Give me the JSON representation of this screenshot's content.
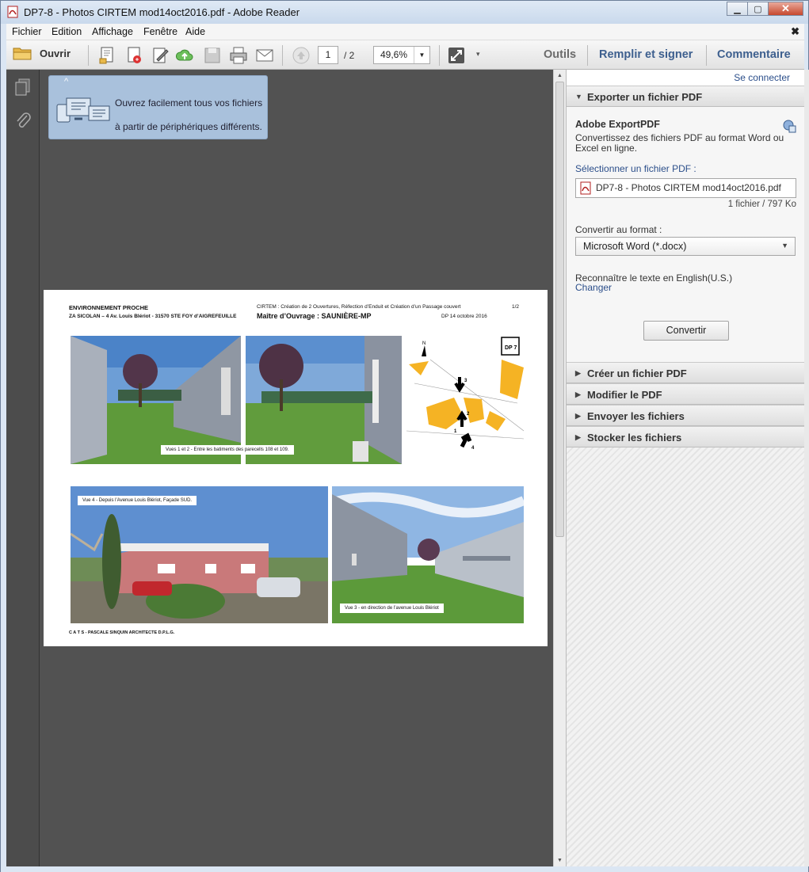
{
  "window": {
    "title": "DP7-8 - Photos CIRTEM mod14oct2016.pdf - Adobe Reader"
  },
  "menu": {
    "items": [
      "Fichier",
      "Edition",
      "Affichage",
      "Fenêtre",
      "Aide"
    ],
    "close_glyph": "✖"
  },
  "toolbar": {
    "open_label": "Ouvrir",
    "page_current": "1",
    "page_total": "/ 2",
    "zoom": "49,6%",
    "tools_label": "Outils",
    "fill_sign_label": "Remplir et signer",
    "comment_label": "Commentaire"
  },
  "promo": {
    "line1": "Ouvrez facilement tous vos fichiers",
    "line2": "à partir de périphériques différents."
  },
  "pdf_page": {
    "env_title": "ENVIRONNEMENT  PROCHE",
    "address": "ZA  SICOLAN – 4 Av. Louis Blériot  - 31570 STE FOY d’AIGREFEUILLE",
    "project": "CIRTEM :  Création de 2 Ouvertures,  Réfection d’Enduit et Création d’un Passage couvert",
    "page_num": "1/2",
    "owner": "Maître d’Ouvrage : SAUNIÈRE-MP",
    "dp_date": "DP 14 octobre 2016",
    "caption_vues12": "Vues 1 et 2  -  Entre les batiments des parecells 108 et 109.",
    "caption_vue4": "Vue 4 -  Depuis l’Avenue Louis Blériot, Façade SUD.",
    "caption_vue3": "Vue 3 -  en direction de l’avenue Louis Blériot",
    "footer": "C  A  T  S   -   PASCALE SINQUIN   ARCHITECTE D.P.L.G.",
    "map_labels": [
      "3",
      "2",
      "1",
      "4",
      "N"
    ],
    "dp_box": "DP 7"
  },
  "right_pane": {
    "sign_in": "Se connecter",
    "export_header": "Exporter un fichier PDF",
    "export_title": "Adobe ExportPDF",
    "export_desc": "Convertissez des fichiers PDF au format Word ou Excel en ligne.",
    "select_label": "Sélectionner un fichier PDF :",
    "file_name": "DP7-8 - Photos CIRTEM mod14oct2016.pdf",
    "file_count": "1 fichier / 797 Ko",
    "convert_to_label": "Convertir au format :",
    "format_value": "Microsoft Word (*.docx)",
    "ocr_text": "Reconnaître le texte en English(U.S.)",
    "change_link": "Changer",
    "convert_button": "Convertir",
    "sections": [
      "Créer un fichier PDF",
      "Modifier le PDF",
      "Envoyer les fichiers",
      "Stocker les fichiers"
    ]
  },
  "colors": {
    "accent_blue": "#2b4e8a",
    "doc_background": "#525252",
    "promo_bg": "#a9c1dc",
    "building_yellow": "#f5b324"
  }
}
